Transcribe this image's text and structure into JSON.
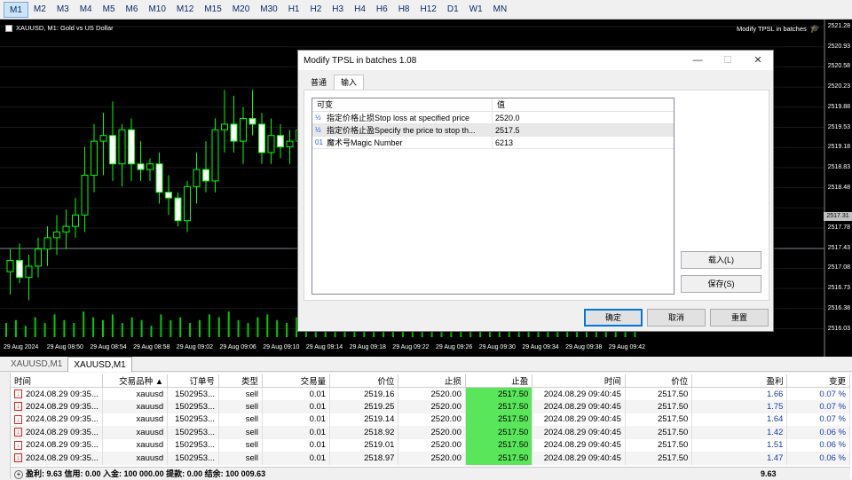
{
  "timeframes": [
    "M1",
    "M2",
    "M3",
    "M4",
    "M5",
    "M6",
    "M10",
    "M12",
    "M15",
    "M20",
    "M30",
    "H1",
    "H2",
    "H3",
    "H4",
    "H6",
    "H8",
    "H12",
    "D1",
    "W1",
    "MN"
  ],
  "active_timeframe": "M1",
  "chart": {
    "title": "XAUUSD, M1:  Gold vs US Dollar",
    "ea_name": "Modify TPSL in batches",
    "current_price": "2517.31",
    "price_axis": [
      "2521.28",
      "2520.93",
      "2520.58",
      "2520.23",
      "2519.88",
      "2519.53",
      "2519.18",
      "2518.83",
      "2518.48",
      "2517.78",
      "2517.43",
      "2517.08",
      "2516.73",
      "2516.38",
      "2516.03"
    ],
    "time_axis": [
      "29 Aug 2024",
      "29 Aug 08:50",
      "29 Aug 08:54",
      "29 Aug 08:58",
      "29 Aug 09:02",
      "29 Aug 09:06",
      "29 Aug 09:10",
      "29 Aug 09:14",
      "29 Aug 09:18",
      "29 Aug 09:22",
      "29 Aug 09:26",
      "29 Aug 09:30",
      "29 Aug 09:34",
      "29 Aug 09:38",
      "29 Aug 09:42"
    ],
    "colors": {
      "bull": "#00ff00",
      "bear": "#ffffff",
      "volume": "#00cc00",
      "grid": "#1a1a1a"
    },
    "candles": [
      {
        "o": 2516.9,
        "h": 2517.3,
        "l": 2516.5,
        "c": 2517.1
      },
      {
        "o": 2517.1,
        "h": 2517.4,
        "l": 2516.7,
        "c": 2516.8
      },
      {
        "o": 2516.8,
        "h": 2517.2,
        "l": 2516.4,
        "c": 2517.0
      },
      {
        "o": 2517.0,
        "h": 2517.5,
        "l": 2516.8,
        "c": 2517.3
      },
      {
        "o": 2517.3,
        "h": 2517.7,
        "l": 2517.0,
        "c": 2517.5
      },
      {
        "o": 2517.5,
        "h": 2517.9,
        "l": 2517.2,
        "c": 2517.6
      },
      {
        "o": 2517.6,
        "h": 2518.0,
        "l": 2517.3,
        "c": 2517.7
      },
      {
        "o": 2517.7,
        "h": 2518.2,
        "l": 2517.5,
        "c": 2517.9
      },
      {
        "o": 2517.9,
        "h": 2519.1,
        "l": 2517.6,
        "c": 2518.6
      },
      {
        "o": 2518.6,
        "h": 2519.5,
        "l": 2518.3,
        "c": 2519.2
      },
      {
        "o": 2519.2,
        "h": 2519.7,
        "l": 2518.6,
        "c": 2519.3
      },
      {
        "o": 2519.3,
        "h": 2519.9,
        "l": 2518.5,
        "c": 2518.8
      },
      {
        "o": 2518.8,
        "h": 2519.5,
        "l": 2518.4,
        "c": 2519.4
      },
      {
        "o": 2519.4,
        "h": 2519.6,
        "l": 2518.5,
        "c": 2518.8
      },
      {
        "o": 2518.8,
        "h": 2519.2,
        "l": 2518.5,
        "c": 2518.7
      },
      {
        "o": 2518.7,
        "h": 2518.9,
        "l": 2518.5,
        "c": 2518.8
      },
      {
        "o": 2518.8,
        "h": 2519.0,
        "l": 2518.1,
        "c": 2518.3
      },
      {
        "o": 2518.3,
        "h": 2518.6,
        "l": 2517.9,
        "c": 2518.2
      },
      {
        "o": 2518.2,
        "h": 2518.3,
        "l": 2517.7,
        "c": 2517.8
      },
      {
        "o": 2517.8,
        "h": 2518.5,
        "l": 2517.6,
        "c": 2518.4
      },
      {
        "o": 2518.4,
        "h": 2519.0,
        "l": 2518.1,
        "c": 2518.7
      },
      {
        "o": 2518.7,
        "h": 2519.2,
        "l": 2518.3,
        "c": 2518.5
      },
      {
        "o": 2518.5,
        "h": 2519.6,
        "l": 2518.3,
        "c": 2519.4
      },
      {
        "o": 2519.4,
        "h": 2520.1,
        "l": 2519.0,
        "c": 2519.5
      },
      {
        "o": 2519.5,
        "h": 2520.0,
        "l": 2519.0,
        "c": 2519.2
      },
      {
        "o": 2519.2,
        "h": 2519.8,
        "l": 2518.8,
        "c": 2519.6
      },
      {
        "o": 2519.6,
        "h": 2520.1,
        "l": 2519.3,
        "c": 2519.5
      },
      {
        "o": 2519.5,
        "h": 2519.7,
        "l": 2518.8,
        "c": 2519.0
      },
      {
        "o": 2519.0,
        "h": 2519.6,
        "l": 2518.8,
        "c": 2519.3
      },
      {
        "o": 2519.3,
        "h": 2519.5,
        "l": 2518.9,
        "c": 2519.1
      },
      {
        "o": 2519.1,
        "h": 2519.4,
        "l": 2518.8,
        "c": 2519.2
      },
      {
        "o": 2519.2,
        "h": 2519.6,
        "l": 2519.0,
        "c": 2519.4
      },
      {
        "o": 2519.4,
        "h": 2519.8,
        "l": 2519.1,
        "c": 2519.3
      }
    ],
    "volumes": [
      5,
      6,
      4,
      7,
      5,
      8,
      6,
      5,
      9,
      7,
      6,
      8,
      5,
      7,
      6,
      4,
      8,
      6,
      7,
      5,
      6,
      8,
      7,
      9,
      6,
      5,
      7,
      8,
      6,
      5,
      7,
      6,
      8,
      5,
      6,
      7,
      8,
      6,
      5,
      7,
      6,
      8,
      7,
      5,
      6,
      7,
      8,
      6,
      5,
      7,
      6,
      8,
      7,
      6,
      5,
      8,
      7,
      6,
      5,
      7,
      6,
      8,
      7,
      6,
      5,
      7
    ]
  },
  "dialog": {
    "title": "Modify TPSL in batches 1.08",
    "tabs": [
      "普通",
      "输入"
    ],
    "active_tab": "输入",
    "grid_headers": [
      "可变",
      "值"
    ],
    "rows": [
      {
        "icon": "½",
        "name": "指定价格止损Stop loss at specified price",
        "value": "2520.0"
      },
      {
        "icon": "½",
        "name": "指定价格止盈Specify the price to stop th...",
        "value": "2517.5"
      },
      {
        "icon": "01",
        "name": "魔术号Magic Number",
        "value": "6213"
      }
    ],
    "load_button": "载入(L)",
    "save_button": "保存(S)",
    "ok_button": "确定",
    "cancel_button": "取消",
    "reset_button": "重置"
  },
  "chart_tabs": [
    "XAUUSD,M1",
    "XAUUSD,M1"
  ],
  "active_chart_tab": 1,
  "trade_table": {
    "headers": [
      "时间",
      "交易品种",
      "订单号",
      "类型",
      "交易量",
      "价位",
      "止损",
      "止盈",
      "时间",
      "价位",
      "盈利",
      "变更"
    ],
    "sort_indicator": "▲",
    "rows": [
      [
        "2024.08.29 09:35...",
        "xauusd",
        "1502953...",
        "sell",
        "0.01",
        "2519.16",
        "2520.00",
        "2517.50",
        "2024.08.29 09:40:45",
        "2517.50",
        "1.66",
        "0.07 %"
      ],
      [
        "2024.08.29 09:35...",
        "xauusd",
        "1502953...",
        "sell",
        "0.01",
        "2519.25",
        "2520.00",
        "2517.50",
        "2024.08.29 09:40:45",
        "2517.50",
        "1.75",
        "0.07 %"
      ],
      [
        "2024.08.29 09:35...",
        "xauusd",
        "1502953...",
        "sell",
        "0.01",
        "2519.14",
        "2520.00",
        "2517.50",
        "2024.08.29 09:40:45",
        "2517.50",
        "1.64",
        "0.07 %"
      ],
      [
        "2024.08.29 09:35...",
        "xauusd",
        "1502953...",
        "sell",
        "0.01",
        "2518.92",
        "2520.00",
        "2517.50",
        "2024.08.29 09:40:45",
        "2517.50",
        "1.42",
        "0.06 %"
      ],
      [
        "2024.08.29 09:35...",
        "xauusd",
        "1502953...",
        "sell",
        "0.01",
        "2519.01",
        "2520.00",
        "2517.50",
        "2024.08.29 09:40:45",
        "2517.50",
        "1.51",
        "0.06 %"
      ],
      [
        "2024.08.29 09:35...",
        "xauusd",
        "1502953...",
        "sell",
        "0.01",
        "2518.97",
        "2520.00",
        "2517.50",
        "2024.08.29 09:40:45",
        "2517.50",
        "1.47",
        "0.06 %"
      ]
    ],
    "summary": "盈利: 9.63  信用: 0.00  入金: 100 000.00  提款: 0.00  结余: 100 009.63",
    "summary_total": "9.63"
  }
}
